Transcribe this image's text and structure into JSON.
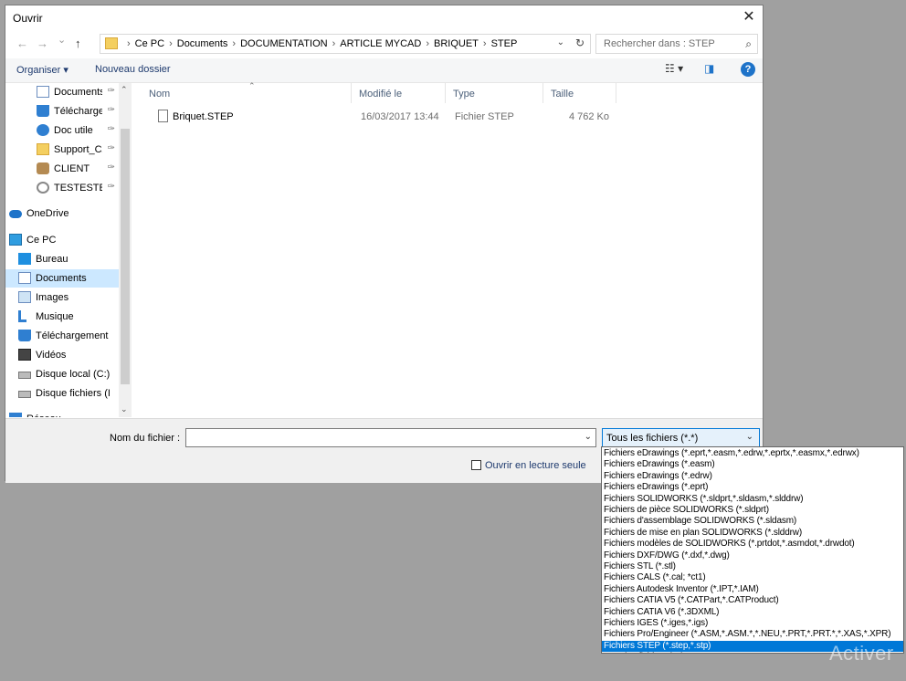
{
  "dialog": {
    "title": "Ouvrir",
    "close_glyph": "✕"
  },
  "nav": {
    "back_glyph": "←",
    "forward_glyph": "→",
    "recent_glyph": "⌄",
    "up_glyph": "↑"
  },
  "address": {
    "crumbs": [
      "Ce PC",
      "Documents",
      "DOCUMENTATION",
      "ARTICLE MYCAD",
      "BRIQUET",
      "STEP"
    ],
    "separator": "›"
  },
  "search": {
    "placeholder": "Rechercher dans : STEP"
  },
  "toolbar": {
    "organize_label": "Organiser ▾",
    "new_folder_label": "Nouveau dossier",
    "help_label": "?"
  },
  "sidebar": {
    "items": [
      {
        "label": "Documents",
        "icon": "documents-icon",
        "pinned": true
      },
      {
        "label": "Téléchargem",
        "icon": "download-icon",
        "pinned": true
      },
      {
        "label": "Doc utile",
        "icon": "info-icon",
        "pinned": true
      },
      {
        "label": "Support_CAC",
        "icon": "folder-icon",
        "pinned": true
      },
      {
        "label": "CLIENT",
        "icon": "people-icon",
        "pinned": true
      },
      {
        "label": "TESTESTESTE",
        "icon": "search-folder-icon",
        "pinned": true
      },
      {
        "label": "OneDrive",
        "icon": "cloud-icon",
        "pinned": false
      },
      {
        "label": "Ce PC",
        "icon": "computer-icon",
        "pinned": false
      },
      {
        "label": "Bureau",
        "icon": "desktop-icon",
        "pinned": false
      },
      {
        "label": "Documents",
        "icon": "documents-icon",
        "pinned": false
      },
      {
        "label": "Images",
        "icon": "images-icon",
        "pinned": false
      },
      {
        "label": "Musique",
        "icon": "music-icon",
        "pinned": false
      },
      {
        "label": "Téléchargement",
        "icon": "download-icon",
        "pinned": false
      },
      {
        "label": "Vidéos",
        "icon": "video-icon",
        "pinned": false
      },
      {
        "label": "Disque local (C:)",
        "icon": "drive-icon",
        "pinned": false
      },
      {
        "label": "Disque fichiers (I",
        "icon": "drive-icon",
        "pinned": false
      },
      {
        "label": "Réseau",
        "icon": "network-icon",
        "pinned": false
      }
    ],
    "selected_index": 9,
    "colors": {
      "selected": "#cce8ff"
    }
  },
  "filelist": {
    "columns": [
      "Nom",
      "Modifié le",
      "Type",
      "Taille"
    ],
    "rows": [
      {
        "name": "Briquet.STEP",
        "modified": "16/03/2017 13:44",
        "type": "Fichier STEP",
        "size": "4 762 Ko"
      }
    ]
  },
  "bottom": {
    "filename_label": "Nom du fichier :",
    "filename_value": "",
    "type_selected": "Tous les fichiers (*.*)",
    "readonly_label": "Ouvrir en lecture seule"
  },
  "filetype_options": [
    "Fichiers eDrawings (*.eprt,*.easm,*.edrw,*.eprtx,*.easmx,*.edrwx)",
    "Fichiers eDrawings (*.easm)",
    "Fichiers eDrawings (*.edrw)",
    "Fichiers eDrawings (*.eprt)",
    "Fichiers SOLIDWORKS (*.sldprt,*.sldasm,*.slddrw)",
    "Fichiers de pièce SOLIDWORKS (*.sldprt)",
    "Fichiers d'assemblage SOLIDWORKS (*.sldasm)",
    "Fichiers de mise en plan SOLIDWORKS (*.slddrw)",
    "Fichiers modèles de SOLIDWORKS (*.prtdot,*.asmdot,*.drwdot)",
    "Fichiers DXF/DWG (*.dxf,*.dwg)",
    "Fichiers STL (*.stl)",
    "Fichiers CALS (*.cal; *ct1)",
    "Fichiers Autodesk Inventor (*.IPT,*.IAM)",
    "Fichiers CATIA V5 (*.CATPart,*.CATProduct)",
    "Fichiers CATIA V6 (*.3DXML)",
    "Fichiers IGES (*.iges,*.igs)",
    "Fichiers Pro/Engineer (*.ASM,*.ASM.*,*.NEU,*.PRT,*.PRT.*,*.XAS,*.XPR)",
    "Fichiers STEP (*.step,*.stp)",
    "Tous les fichiers (*.*)"
  ],
  "filetype_highlighted_index": 17,
  "watermark": "Activer",
  "colors": {
    "accent": "#0078d7",
    "link": "#1e3a6e",
    "background": "#a0a0a0"
  }
}
